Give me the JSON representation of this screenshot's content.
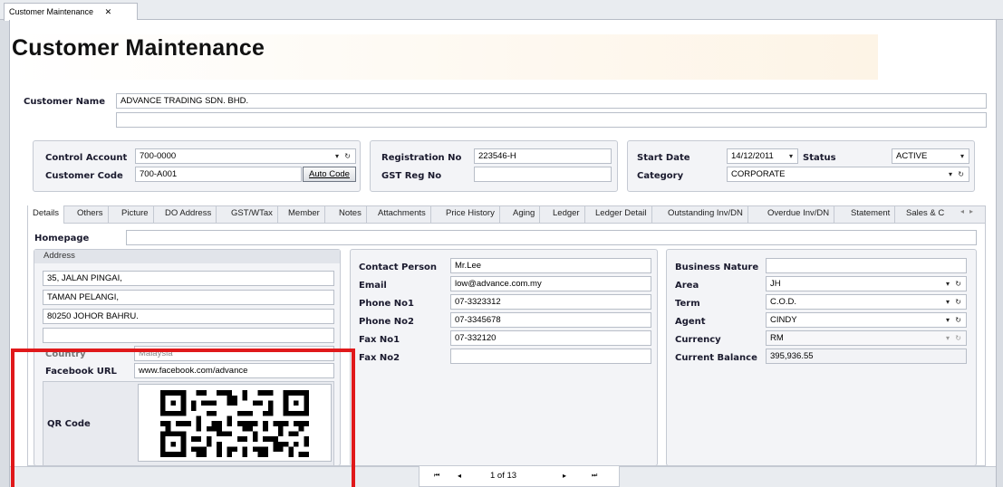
{
  "doc_tab": {
    "label": "Customer Maintenance",
    "close": "✕"
  },
  "page_title": "Customer Maintenance",
  "customer_name": {
    "label": "Customer Name",
    "value": "ADVANCE TRADING SDN. BHD.",
    "value2": ""
  },
  "account": {
    "control_account_label": "Control Account",
    "control_account_value": "700-0000",
    "customer_code_label": "Customer Code",
    "customer_code_value": "700-A001",
    "auto_code_label": "Auto Code"
  },
  "registration": {
    "reg_no_label": "Registration No",
    "reg_no_value": "223546-H",
    "gst_label": "GST Reg No",
    "gst_value": ""
  },
  "status_box": {
    "start_date_label": "Start Date",
    "start_date_value": "14/12/2011",
    "status_label": "Status",
    "status_value": "ACTIVE",
    "category_label": "Category",
    "category_value": "CORPORATE"
  },
  "tabs": [
    "Details",
    "Others",
    "Picture",
    "DO Address",
    "GST/WTax",
    "Member",
    "Notes",
    "Attachments",
    "Price History",
    "Aging",
    "Ledger",
    "Ledger Detail",
    "Outstanding Inv/DN",
    "Overdue Inv/DN",
    "Statement",
    "Sales & C"
  ],
  "homepage": {
    "label": "Homepage",
    "value": ""
  },
  "address": {
    "header": "Address",
    "lines": [
      "35, JALAN PINGAI,",
      "TAMAN PELANGI,",
      "80250 JOHOR BAHRU.",
      ""
    ],
    "country_label": "Country",
    "country_value": "Malaysia",
    "facebook_label": "Facebook URL",
    "facebook_value": "www.facebook.com/advance",
    "qr_label": "QR Code"
  },
  "contact": {
    "person_label": "Contact Person",
    "person_value": "Mr.Lee",
    "email_label": "Email",
    "email_value": "low@advance.com.my",
    "phone1_label": "Phone No1",
    "phone1_value": "07-3323312",
    "phone2_label": "Phone No2",
    "phone2_value": "07-3345678",
    "fax1_label": "Fax No1",
    "fax1_value": "07-332120",
    "fax2_label": "Fax No2",
    "fax2_value": ""
  },
  "business": {
    "nature_label": "Business Nature",
    "nature_value": "",
    "area_label": "Area",
    "area_value": "JH",
    "term_label": "Term",
    "term_value": "C.O.D.",
    "agent_label": "Agent",
    "agent_value": "CINDY",
    "currency_label": "Currency",
    "currency_value": "RM",
    "balance_label": "Current Balance",
    "balance_value": "395,936.55"
  },
  "navigator": {
    "first": "⏮",
    "prev": "◂",
    "page": "1 of 13",
    "next": "▸",
    "last": "⏭"
  },
  "colors": {
    "highlight": "#e0191b",
    "title_band": "#fdf4e6"
  }
}
